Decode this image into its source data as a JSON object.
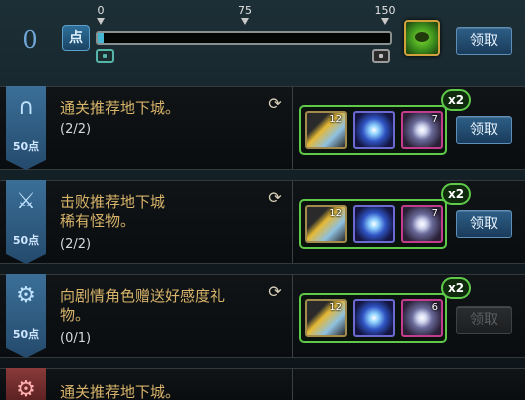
{
  "points": {
    "value": "0",
    "chip_label": "点"
  },
  "progress": {
    "current": 0,
    "max": 150,
    "fill_fraction": 0.02,
    "ticks": [
      "0",
      "75",
      "150"
    ]
  },
  "top_claim_label": "领取",
  "quests": [
    {
      "badge_points": "50点",
      "badge_icon": "arch-icon",
      "title_lines": [
        "通关推荐地下城。",
        ""
      ],
      "progress": "(2/2)",
      "multiplier": "x2",
      "items": [
        {
          "type": "ticket",
          "count": "12"
        },
        {
          "type": "orb-blue",
          "count": ""
        },
        {
          "type": "orb-pink",
          "count": "7"
        }
      ],
      "claim_label": "领取",
      "claim_enabled": true
    },
    {
      "badge_points": "50点",
      "badge_icon": "sword-icon",
      "title_lines": [
        "击败推荐地下城",
        "稀有怪物。"
      ],
      "progress": "(2/2)",
      "multiplier": "x2",
      "items": [
        {
          "type": "ticket",
          "count": "12"
        },
        {
          "type": "orb-blue",
          "count": ""
        },
        {
          "type": "orb-pink",
          "count": "7"
        }
      ],
      "claim_label": "领取",
      "claim_enabled": true
    },
    {
      "badge_points": "50点",
      "badge_icon": "gear-icon",
      "title_lines": [
        "向剧情角色赠送好感度礼",
        "物。"
      ],
      "progress": "(0/1)",
      "multiplier": "x2",
      "items": [
        {
          "type": "ticket",
          "count": "12"
        },
        {
          "type": "orb-blue",
          "count": ""
        },
        {
          "type": "orb-pink",
          "count": "6"
        }
      ],
      "claim_label": "领取",
      "claim_enabled": false
    },
    {
      "title_lines": [
        "通关推荐地下城。"
      ]
    }
  ]
}
